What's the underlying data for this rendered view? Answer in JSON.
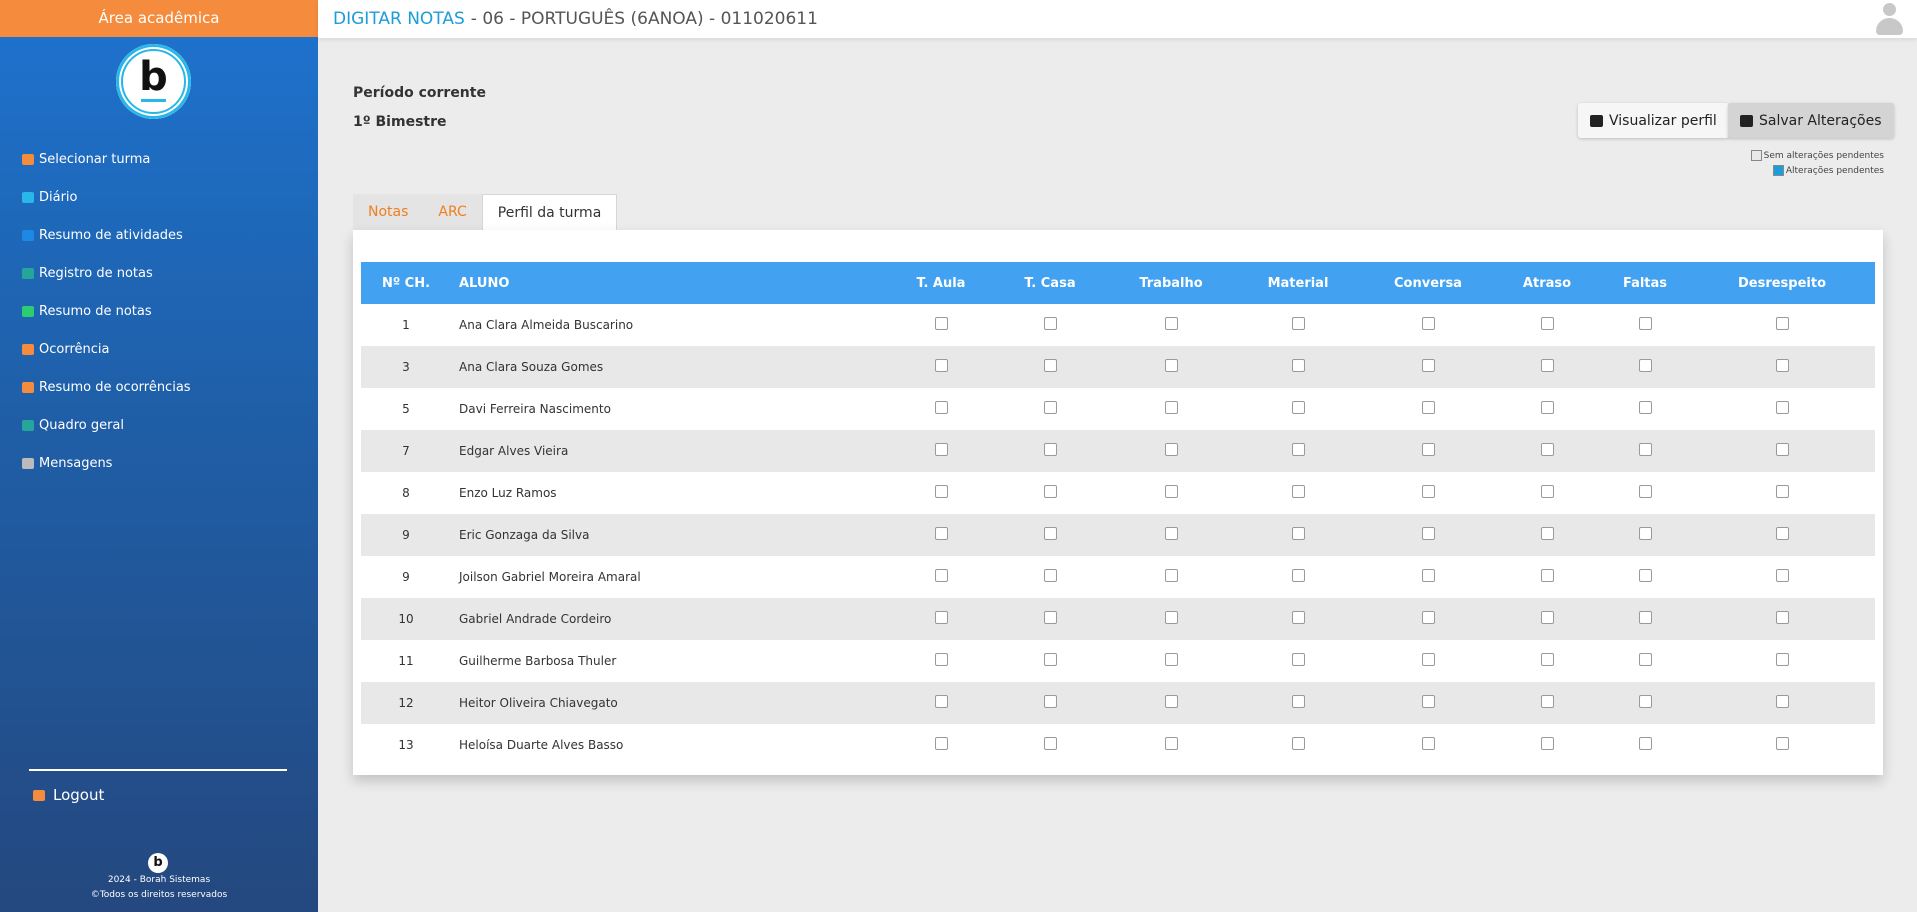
{
  "sidebar": {
    "header": "Área acadêmica",
    "logo_letter": "b",
    "items": [
      {
        "label": "Selecionar turma",
        "icon": "users-icon",
        "color": "#f58b3c"
      },
      {
        "label": "Diário",
        "icon": "calendar-icon",
        "color": "#29b6e8"
      },
      {
        "label": "Resumo de atividades",
        "icon": "file-icon",
        "color": "#1e88e5"
      },
      {
        "label": "Registro de notas",
        "icon": "file-text-icon",
        "color": "#26a69a"
      },
      {
        "label": "Resumo de notas",
        "icon": "book-icon",
        "color": "#2ecc71"
      },
      {
        "label": "Ocorrência",
        "icon": "alert-icon",
        "color": "#f58b3c"
      },
      {
        "label": "Resumo de ocorrências",
        "icon": "file-alert-icon",
        "color": "#f58b3c"
      },
      {
        "label": "Quadro geral",
        "icon": "clipboard-icon",
        "color": "#26a69a"
      },
      {
        "label": "Mensagens",
        "icon": "envelope-icon",
        "color": "#bbbbbb"
      }
    ],
    "logout": "Logout",
    "footer_line1": "2024 - Borah Sistemas",
    "footer_line2": "©Todos os direitos reservados"
  },
  "topbar": {
    "title_accent": "DIGITAR NOTAS",
    "title_rest": "- 06 - PORTUGUÊS (6ANOA) - 011020611"
  },
  "period": {
    "label": "Período corrente",
    "value": "1º Bimestre"
  },
  "buttons": {
    "view_profile": "Visualizar perfil",
    "save": "Salvar Alterações"
  },
  "legend": {
    "no_pending": "Sem alterações pendentes",
    "pending": "Alterações pendentes",
    "pending_color": "#1a9dd8"
  },
  "tabs": [
    "Notas",
    "ARC",
    "Perfil da turma"
  ],
  "table": {
    "columns": [
      "Nº CH.",
      "ALUNO",
      "T. Aula",
      "T. Casa",
      "Trabalho",
      "Material",
      "Conversa",
      "Atraso",
      "Faltas",
      "Desrespeito"
    ],
    "rows": [
      {
        "num": "1",
        "name": "Ana Clara Almeida Buscarino"
      },
      {
        "num": "3",
        "name": "Ana Clara Souza Gomes"
      },
      {
        "num": "5",
        "name": "Davi Ferreira Nascimento"
      },
      {
        "num": "7",
        "name": "Edgar Alves Vieira"
      },
      {
        "num": "8",
        "name": "Enzo Luz Ramos"
      },
      {
        "num": "9",
        "name": "Eric Gonzaga da Silva"
      },
      {
        "num": "9",
        "name": "Joilson Gabriel Moreira Amaral"
      },
      {
        "num": "10",
        "name": "Gabriel Andrade Cordeiro"
      },
      {
        "num": "11",
        "name": "Guilherme Barbosa Thuler"
      },
      {
        "num": "12",
        "name": "Heitor Oliveira Chiavegato"
      },
      {
        "num": "13",
        "name": "Heloísa Duarte Alves Basso"
      }
    ]
  }
}
